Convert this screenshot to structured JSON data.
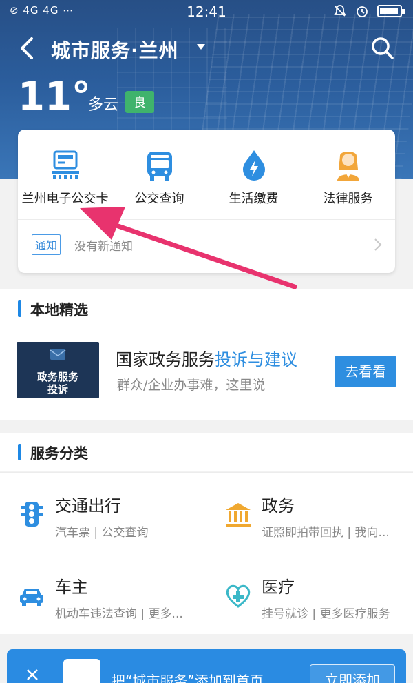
{
  "status_bar": {
    "left": "⊘ 4G 4G ⋯",
    "time": "12:41"
  },
  "navbar": {
    "title": "城市服务·兰州"
  },
  "weather": {
    "temperature": "11°",
    "condition": "多云",
    "air_quality": "良"
  },
  "quick_services": [
    {
      "label": "兰州电子公交卡",
      "icon": "bus-card-icon"
    },
    {
      "label": "公交查询",
      "icon": "bus-icon"
    },
    {
      "label": "生活缴费",
      "icon": "utility-drop-icon"
    },
    {
      "label": "法律服务",
      "icon": "judge-icon"
    }
  ],
  "notice": {
    "tag": "通知",
    "text": "没有新通知"
  },
  "local_picks": {
    "heading": "本地精选",
    "card": {
      "thumb_line1": "政务服务",
      "thumb_line2": "投诉",
      "title_prefix": "国家政务服务",
      "title_highlight": "投诉与建议",
      "subtitle": "群众/企业办事难，这里说",
      "button": "去看看"
    }
  },
  "service_categories": {
    "heading": "服务分类",
    "items": [
      {
        "name": "交通出行",
        "desc": "汽车票 | 公交查询",
        "icon": "traffic-light-icon"
      },
      {
        "name": "政务",
        "desc": "证照即拍带回执 | 我向...",
        "icon": "government-building-icon"
      },
      {
        "name": "车主",
        "desc": "机动车违法查询 | 更多...",
        "icon": "car-icon"
      },
      {
        "name": "医疗",
        "desc": "挂号就诊 | 更多医疗服务",
        "icon": "medical-heart-icon"
      }
    ]
  },
  "add_banner": {
    "text": "把“城市服务”添加到首页",
    "button": "立即添加"
  },
  "colors": {
    "accent": "#2e8ee0",
    "header": "#2b5d9c",
    "aqi_good": "#3fb36c",
    "annotation_arrow": "#e8336e"
  }
}
